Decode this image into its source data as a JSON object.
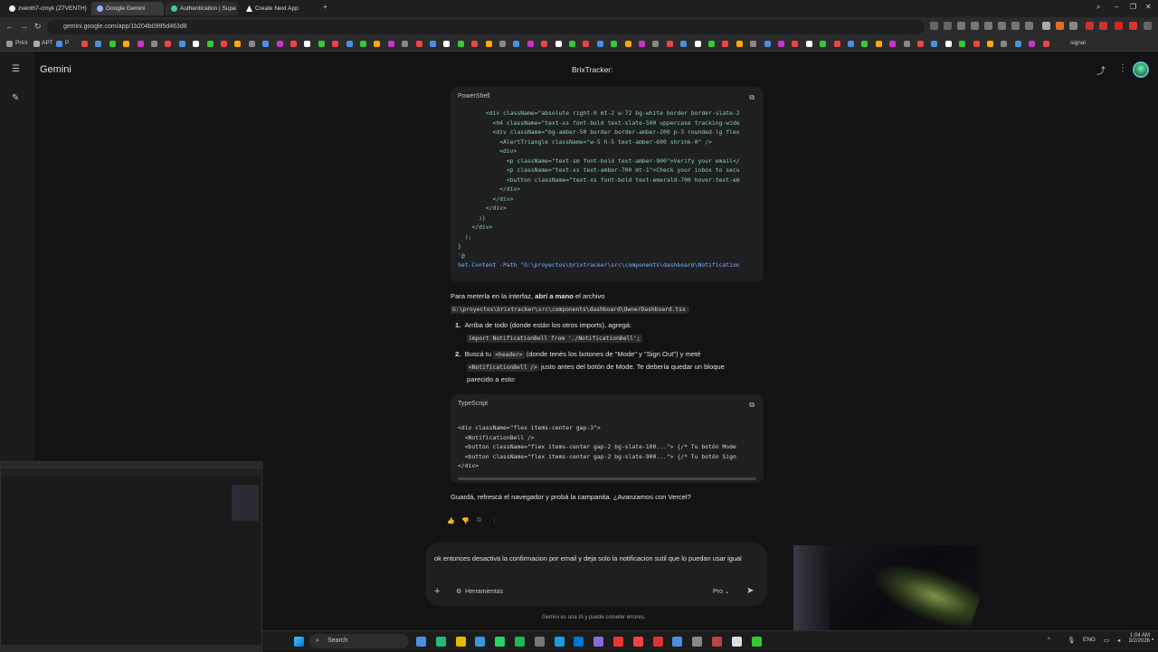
{
  "browser": {
    "tabs": [
      {
        "label": "zventh7-cmyk (Z7VENTH)",
        "active": false
      },
      {
        "label": "Google Gemini",
        "active": true
      },
      {
        "label": "Authentication | Supa",
        "active": false
      },
      {
        "label": "Create Next App",
        "active": false
      }
    ],
    "url": "gemini.google.com/app/1b204b0995d463d8",
    "bookmarks": {
      "first": "Print",
      "second": "APT",
      "third": "P",
      "last": "signal"
    }
  },
  "gemini": {
    "app_title": "Gemini",
    "chat_title": "BrixTracker:",
    "code_block_1": {
      "lang": "PowerShell",
      "lines": [
        "        <div className=\"absolute right-0 mt-2 w-72 bg-white border border-slate-2",
        "          <h4 className=\"text-xs font-bold text-slate-500 uppercase tracking-wide",
        "          <div className=\"bg-amber-50 border border-amber-200 p-3 rounded-lg flex",
        "            <AlertTriangle className=\"w-5 h-5 text-amber-600 shrink-0\" />",
        "            <div>",
        "              <p className=\"text-sm font-bold text-amber-900\">Verify your email</",
        "              <p className=\"text-xs text-amber-700 mt-1\">Check your inbox to secu",
        "              <button className=\"text-xs font-bold text-emerald-700 hover:text-em",
        "            </div>",
        "          </div>",
        "        </div>",
        "      )}",
        "    </div>",
        "  );",
        "}",
        "'@",
        "Set-Content -Path \"G:\\proyectos\\brixtracker\\src\\components\\dashboard\\Notification"
      ]
    },
    "para_1": {
      "before": "Para meterla en la interfaz, ",
      "bold": "abrí a mano",
      "after": " el archivo",
      "path": "G:\\proyectos\\brixtracker\\src\\components\\dashboard\\OwnerDashboard.tsx",
      "colon": ":"
    },
    "step_1": {
      "num": "1.",
      "text": "Arriba de todo (donde están los otros imports), agregá:",
      "code": "import NotificationBell from './NotificationBell';"
    },
    "step_2": {
      "num": "2.",
      "before": "Buscá tu ",
      "code_header": "<header>",
      "middle": " (donde tenés los botones de \"Mode\" y \"Sign Out\") y meté",
      "code_bell": "<NotificationBell />",
      "after": " justo antes del botón de Mode. Te debería quedar un bloque",
      "line3": "parecido a esto:"
    },
    "code_block_2": {
      "lang": "TypeScript",
      "lines": [
        "<div className=\"flex items-center gap-3\">",
        "  <NotificationBell />",
        "  <button className=\"flex items-center gap-2 bg-slate-100...\"> {/* Tu botón Mode",
        "  <button className=\"flex items-center gap-2 bg-slate-900...\"> {/* Tu botón Sign",
        "</div>"
      ]
    },
    "closing": "Guardá, refrescá el navegador y probá la campanita. ¿Avanzamos con Vercel?",
    "input": {
      "value": "ok entonces desactiva la confirmacion por email y deja solo la notificacion sutil que lo puedan usar igual",
      "tools_label": "Herramientas",
      "model_label": "Pro"
    },
    "disclaimer": "Gemini es una IA y puede cometer errores."
  },
  "taskbar": {
    "search_label": "Search",
    "lang": "ENG",
    "time": "1:04 AM",
    "date": "3/2/2026"
  },
  "colors": {
    "bg": "#131314",
    "code_bg": "#1e1f20",
    "accent_green": "#8fd1a8"
  }
}
